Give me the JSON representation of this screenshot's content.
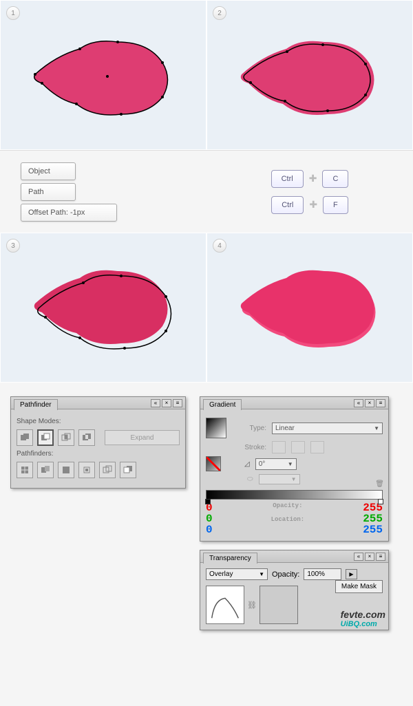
{
  "steps": {
    "s1": "1",
    "s2": "2",
    "s3": "3",
    "s4": "4"
  },
  "menu": {
    "object": "Object",
    "path": "Path",
    "offset": "Offset Path: -1px"
  },
  "keys": {
    "ctrl": "Ctrl",
    "c": "C",
    "f": "F"
  },
  "pathfinder": {
    "title": "Pathfinder",
    "shape_modes": "Shape Modes:",
    "expand": "Expand",
    "pathfinders": "Pathfinders:"
  },
  "gradient": {
    "title": "Gradient",
    "type_label": "Type:",
    "type_value": "Linear",
    "stroke": "Stroke:",
    "angle": "0°",
    "ratio": "",
    "opacity": "Opacity:",
    "location": "Location:",
    "left": {
      "r": "0",
      "g": "0",
      "b": "0"
    },
    "right": {
      "r": "255",
      "g": "255",
      "b": "255"
    }
  },
  "transparency": {
    "title": "Transparency",
    "mode": "Overlay",
    "opacity_label": "Opacity:",
    "opacity_value": "100%",
    "make_mask": "Make Mask"
  },
  "watermark": {
    "line1": "fevte.com",
    "line2": "UiBQ.com"
  }
}
